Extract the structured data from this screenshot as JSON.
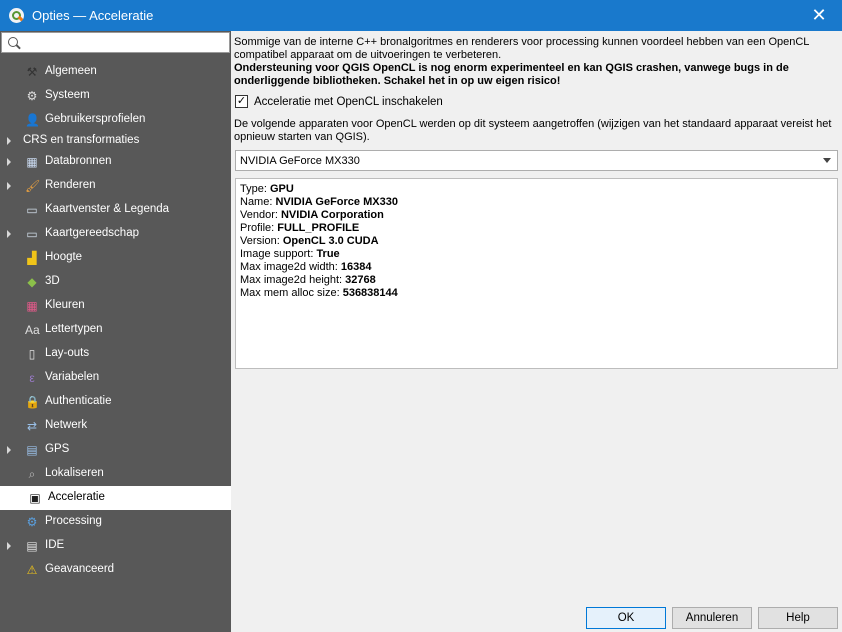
{
  "window": {
    "title": "Opties — Acceleratie",
    "close_glyph": "✕"
  },
  "search": {
    "value": "",
    "placeholder": ""
  },
  "sidebar": {
    "items": [
      {
        "label": "Algemeen",
        "icon": "hammer-icon",
        "glyph": "⚒",
        "color": "#333333",
        "expandable": false,
        "active": false,
        "has_icon": true
      },
      {
        "label": "Systeem",
        "icon": "gears-icon",
        "glyph": "⚙",
        "color": "#e0e0e0",
        "expandable": false,
        "active": false,
        "has_icon": true
      },
      {
        "label": "Gebruikersprofielen",
        "icon": "user-icon",
        "glyph": "👤",
        "color": "#333333",
        "expandable": false,
        "active": false,
        "has_icon": true
      },
      {
        "label": "CRS en transformaties",
        "icon": "",
        "glyph": "",
        "color": "",
        "expandable": true,
        "active": false,
        "has_icon": false
      },
      {
        "label": "Databronnen",
        "icon": "table-icon",
        "glyph": "▦",
        "color": "#c9d9ef",
        "expandable": true,
        "active": false,
        "has_icon": true
      },
      {
        "label": "Renderen",
        "icon": "brush-icon",
        "glyph": "🖌",
        "color": "#e8a040",
        "expandable": true,
        "active": false,
        "has_icon": true
      },
      {
        "label": "Kaartvenster & Legenda",
        "icon": "map-canvas-icon",
        "glyph": "▭",
        "color": "#d0dce8",
        "expandable": false,
        "active": false,
        "has_icon": true
      },
      {
        "label": "Kaartgereedschap",
        "icon": "map-tools-icon",
        "glyph": "▭",
        "color": "#d0dce8",
        "expandable": true,
        "active": false,
        "has_icon": true
      },
      {
        "label": "Hoogte",
        "icon": "elevation-icon",
        "glyph": "▟",
        "color": "#f0c419",
        "expandable": false,
        "active": false,
        "has_icon": true
      },
      {
        "label": "3D",
        "icon": "cube-3d-icon",
        "glyph": "◆",
        "color": "#8cc04a",
        "expandable": false,
        "active": false,
        "has_icon": true
      },
      {
        "label": "Kleuren",
        "icon": "colors-icon",
        "glyph": "▦",
        "color": "#e35a8a",
        "expandable": false,
        "active": false,
        "has_icon": true
      },
      {
        "label": "Lettertypen",
        "icon": "fonts-icon",
        "glyph": "Aa",
        "color": "#e0e0e0",
        "expandable": false,
        "active": false,
        "has_icon": true
      },
      {
        "label": "Lay-outs",
        "icon": "layout-icon",
        "glyph": "▯",
        "color": "#e0e0e0",
        "expandable": false,
        "active": false,
        "has_icon": true
      },
      {
        "label": "Variabelen",
        "icon": "variables-icon",
        "glyph": "ε",
        "color": "#9a7ac8",
        "expandable": false,
        "active": false,
        "has_icon": true
      },
      {
        "label": "Authenticatie",
        "icon": "lock-icon",
        "glyph": "🔒",
        "color": "#f0c419",
        "expandable": false,
        "active": false,
        "has_icon": true
      },
      {
        "label": "Netwerk",
        "icon": "network-icon",
        "glyph": "⇄",
        "color": "#9ac0e8",
        "expandable": false,
        "active": false,
        "has_icon": true
      },
      {
        "label": "GPS",
        "icon": "gps-icon",
        "glyph": "▤",
        "color": "#9ac0e8",
        "expandable": true,
        "active": false,
        "has_icon": true
      },
      {
        "label": "Lokaliseren",
        "icon": "search-icon",
        "glyph": "⌕",
        "color": "#bbbbbb",
        "expandable": false,
        "active": false,
        "has_icon": true
      },
      {
        "label": "Acceleratie",
        "icon": "chip-icon",
        "glyph": "▣",
        "color": "#222222",
        "expandable": false,
        "active": true,
        "has_icon": true
      },
      {
        "label": "Processing",
        "icon": "processing-gear-icon",
        "glyph": "⚙",
        "color": "#5aa0e0",
        "expandable": false,
        "active": false,
        "has_icon": true
      },
      {
        "label": "IDE",
        "icon": "ide-icon",
        "glyph": "▤",
        "color": "#e0e0e0",
        "expandable": true,
        "active": false,
        "has_icon": true
      },
      {
        "label": "Geavanceerd",
        "icon": "warning-icon",
        "glyph": "⚠",
        "color": "#f0c419",
        "expandable": false,
        "active": false,
        "has_icon": true
      }
    ]
  },
  "main": {
    "intro_text": "Sommige van de interne C++ bronalgoritmes en renderers voor processing kunnen voordeel hebben van een OpenCL compatibel apparaat om de uitvoeringen te verbeteren.",
    "warning_text": "Ondersteuning voor QGIS OpenCL is nog enorm experimenteel en kan QGIS crashen, vanwege bugs in de onderliggende bibliotheken. Schakel het in op uw eigen risico!",
    "enable_checkbox": {
      "label": "Acceleratie met OpenCL inschakelen",
      "checked": true,
      "check_glyph": "✓"
    },
    "devices_text": "De volgende apparaten voor OpenCL werden op dit systeem aangetroffen (wijzigen van het standaard apparaat vereist het opnieuw starten van QGIS).",
    "device_select": {
      "value": "NVIDIA GeForce MX330"
    },
    "device_info": [
      {
        "key": "Type: ",
        "value": "GPU"
      },
      {
        "key": "Name: ",
        "value": "NVIDIA GeForce MX330"
      },
      {
        "key": "Vendor: ",
        "value": "NVIDIA Corporation"
      },
      {
        "key": "Profile: ",
        "value": "FULL_PROFILE"
      },
      {
        "key": "Version: ",
        "value": "OpenCL 3.0 CUDA"
      },
      {
        "key": "Image support: ",
        "value": "True"
      },
      {
        "key": "Max image2d width: ",
        "value": "16384"
      },
      {
        "key": "Max image2d height: ",
        "value": "32768"
      },
      {
        "key": "Max mem alloc size: ",
        "value": "536838144"
      }
    ]
  },
  "buttons": {
    "ok": "OK",
    "cancel": "Annuleren",
    "help": "Help"
  },
  "colors": {
    "titlebar": "#1979cc",
    "sidebar": "#585858",
    "accent": "#0078d7"
  }
}
